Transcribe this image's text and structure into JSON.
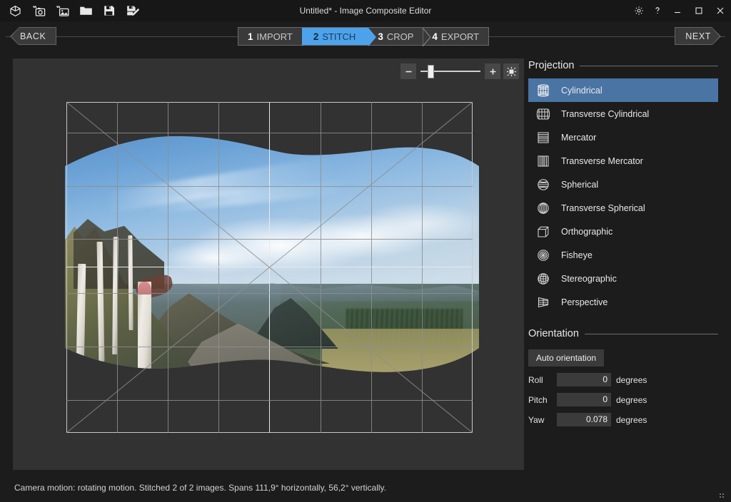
{
  "window": {
    "title": "Untitled* - Image Composite Editor",
    "toolbar": [
      {
        "name": "view-3d-icon",
        "label": "3D view"
      },
      {
        "name": "add-images-from-camera-icon",
        "label": "Add images from camera"
      },
      {
        "name": "add-images-icon",
        "label": "Add images"
      },
      {
        "name": "open-folder-icon",
        "label": "Open"
      },
      {
        "name": "save-icon",
        "label": "Save"
      },
      {
        "name": "save-as-icon",
        "label": "Save as"
      }
    ],
    "system": [
      {
        "name": "gear-icon",
        "label": "Settings"
      },
      {
        "name": "help-icon",
        "label": "Help"
      },
      {
        "name": "minimize-icon",
        "label": "Minimize"
      },
      {
        "name": "maximize-icon",
        "label": "Maximize"
      },
      {
        "name": "close-icon",
        "label": "Close"
      }
    ]
  },
  "nav": {
    "back_label": "BACK",
    "next_label": "NEXT",
    "steps": [
      {
        "num": "1",
        "label": "IMPORT",
        "active": false
      },
      {
        "num": "2",
        "label": "STITCH",
        "active": true
      },
      {
        "num": "3",
        "label": "CROP",
        "active": false
      },
      {
        "num": "4",
        "label": "EXPORT",
        "active": false
      }
    ],
    "active_color": "#4da2ec"
  },
  "canvas": {
    "zoom": {
      "minus_label": "−",
      "plus_label": "+",
      "fit_label": "Fit to window",
      "slider_value": 14
    }
  },
  "projection": {
    "title": "Projection",
    "selected": "Cylindrical",
    "highlight_color": "#4a74a4",
    "items": [
      {
        "label": "Cylindrical",
        "icon": "cylindrical-icon"
      },
      {
        "label": "Transverse Cylindrical",
        "icon": "transverse-cylindrical-icon"
      },
      {
        "label": "Mercator",
        "icon": "mercator-icon"
      },
      {
        "label": "Transverse Mercator",
        "icon": "transverse-mercator-icon"
      },
      {
        "label": "Spherical",
        "icon": "spherical-icon"
      },
      {
        "label": "Transverse Spherical",
        "icon": "transverse-spherical-icon"
      },
      {
        "label": "Orthographic",
        "icon": "orthographic-icon"
      },
      {
        "label": "Fisheye",
        "icon": "fisheye-icon"
      },
      {
        "label": "Stereographic",
        "icon": "stereographic-icon"
      },
      {
        "label": "Perspective",
        "icon": "perspective-icon"
      }
    ]
  },
  "orientation": {
    "title": "Orientation",
    "auto_label": "Auto orientation",
    "fields": [
      {
        "label": "Roll",
        "value": "0",
        "unit": "degrees"
      },
      {
        "label": "Pitch",
        "value": "0",
        "unit": "degrees"
      },
      {
        "label": "Yaw",
        "value": "0.078",
        "unit": "degrees"
      }
    ]
  },
  "status": {
    "text": "Camera motion: rotating motion. Stitched 2 of 2 images. Spans 111,9° horizontally, 56,2° vertically."
  }
}
